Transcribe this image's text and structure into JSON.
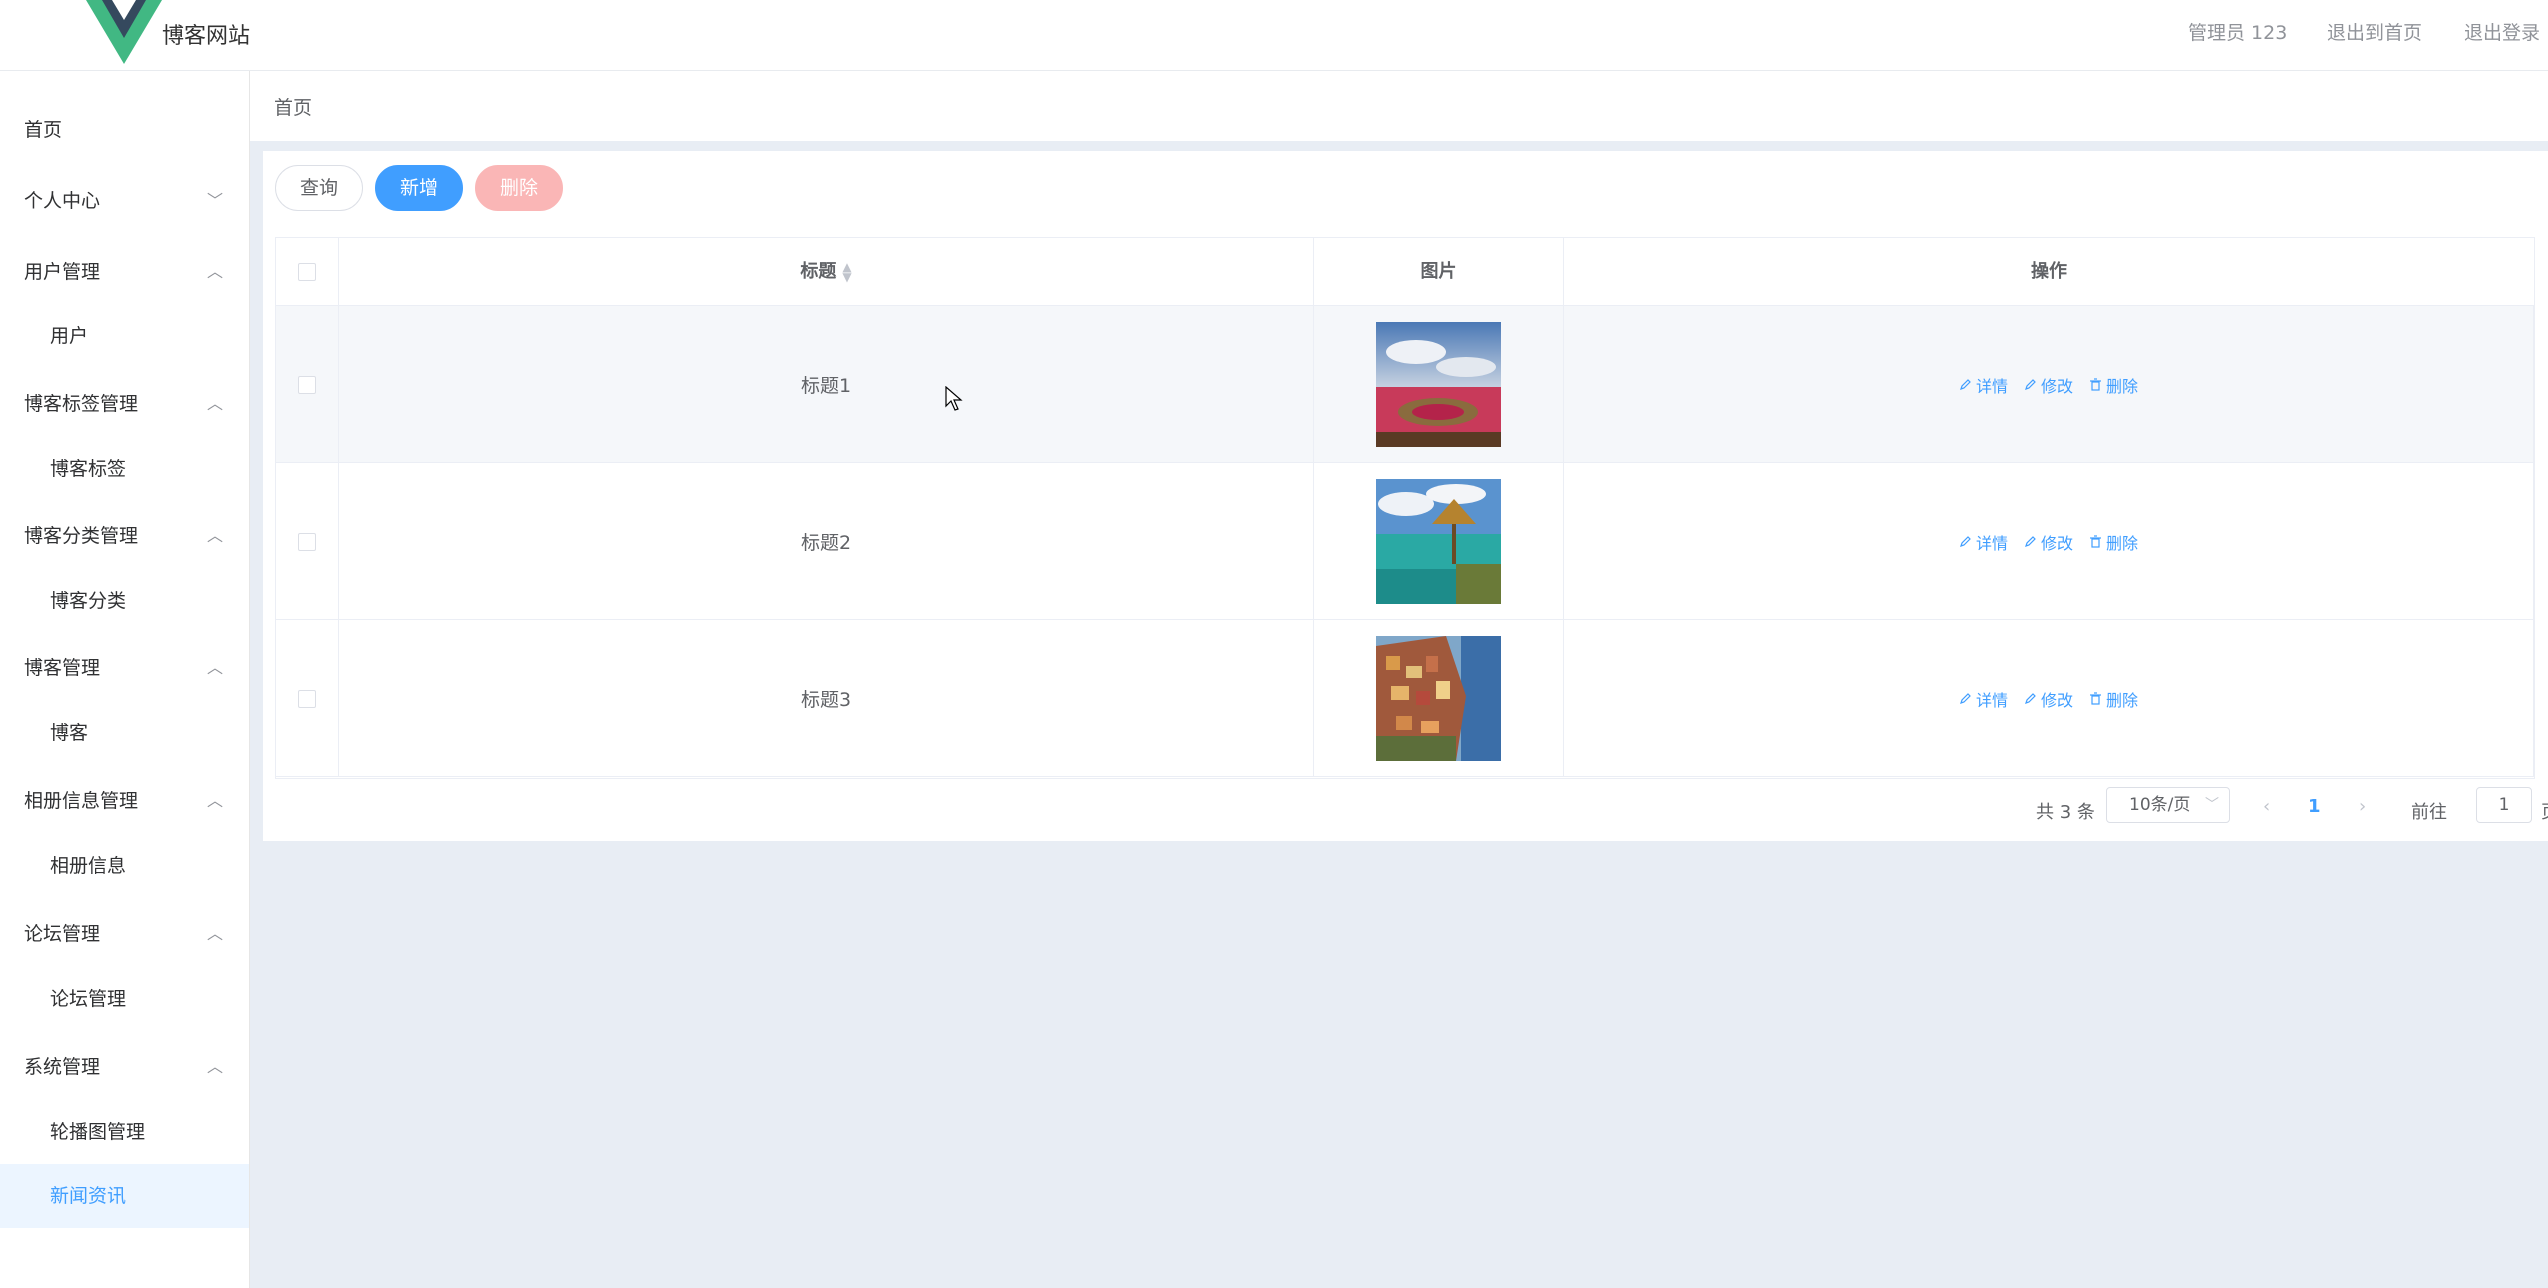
{
  "header": {
    "site_title": "博客网站",
    "admin_label": "管理员 123",
    "back_home": "退出到首页",
    "logout": "退出登录"
  },
  "sidebar": {
    "home": "首页",
    "personal_center": "个人中心",
    "groups": [
      {
        "title": "用户管理",
        "items": [
          "用户"
        ]
      },
      {
        "title": "博客标签管理",
        "items": [
          "博客标签"
        ]
      },
      {
        "title": "博客分类管理",
        "items": [
          "博客分类"
        ]
      },
      {
        "title": "博客管理",
        "items": [
          "博客"
        ]
      },
      {
        "title": "相册信息管理",
        "items": [
          "相册信息"
        ]
      },
      {
        "title": "论坛管理",
        "items": [
          "论坛管理"
        ]
      },
      {
        "title": "系统管理",
        "items": [
          "轮播图管理",
          "新闻资讯"
        ]
      }
    ],
    "active_item": "新闻资讯"
  },
  "breadcrumb": "首页",
  "toolbar": {
    "query": "查询",
    "add": "新增",
    "delete": "删除"
  },
  "table": {
    "columns": [
      "标题",
      "图片",
      "操作"
    ],
    "rows": [
      {
        "title": "标题1",
        "image": "photo-crater-landscape"
      },
      {
        "title": "标题2",
        "image": "photo-tropical-beach"
      },
      {
        "title": "标题3",
        "image": "photo-cliff-village"
      }
    ],
    "actions": {
      "detail": "详情",
      "edit": "修改",
      "delete": "删除"
    }
  },
  "pagination": {
    "total": "共 3 条",
    "page_size": "10条/页",
    "current_page": "1",
    "goto_label": "前往",
    "goto_value": "1",
    "page_suffix": "页"
  },
  "colors": {
    "primary": "#409eff",
    "danger_light": "#fab6b6",
    "active_bg": "#ecf5ff",
    "page_bg": "#e8edf4"
  }
}
